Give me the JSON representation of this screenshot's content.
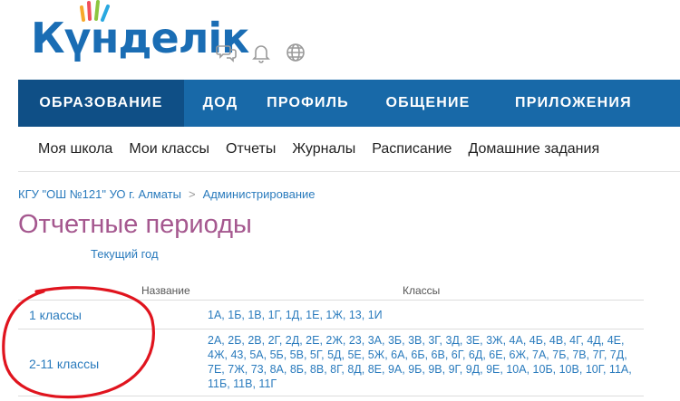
{
  "logo": {
    "text": "Күнделік"
  },
  "icons": [
    "chat-icon",
    "bell-icon",
    "globe-icon"
  ],
  "main_nav": [
    "ОБРАЗОВАНИЕ",
    "ДОД",
    "ПРОФИЛЬ",
    "ОБЩЕНИЕ",
    "ПРИЛОЖЕНИЯ"
  ],
  "sub_nav": [
    "Моя школа",
    "Мои классы",
    "Отчеты",
    "Журналы",
    "Расписание",
    "Домашние задания"
  ],
  "breadcrumb": [
    "КГУ \"ОШ №121\" УО г. Алматы",
    "Администрирование"
  ],
  "breadcrumb_sep": ">",
  "page_title": "Отчетные периоды",
  "subtitle": "Текущий год",
  "table": {
    "headers": {
      "name": "Название",
      "classes": "Классы"
    },
    "rows": [
      {
        "name": "1 классы",
        "classes": [
          "1А",
          "1Б",
          "1В",
          "1Г",
          "1Д",
          "1Е",
          "1Ж",
          "13",
          "1И"
        ]
      },
      {
        "name": "2-11 классы",
        "classes": [
          "2А",
          "2Б",
          "2В",
          "2Г",
          "2Д",
          "2Е",
          "2Ж",
          "23",
          "3А",
          "3Б",
          "3В",
          "3Г",
          "3Д",
          "3Е",
          "3Ж",
          "4А",
          "4Б",
          "4В",
          "4Г",
          "4Д",
          "4Е",
          "4Ж",
          "43",
          "5А",
          "5Б",
          "5В",
          "5Г",
          "5Д",
          "5Е",
          "5Ж",
          "6А",
          "6Б",
          "6В",
          "6Г",
          "6Д",
          "6Е",
          "6Ж",
          "7А",
          "7Б",
          "7В",
          "7Г",
          "7Д",
          "7Е",
          "7Ж",
          "73",
          "8А",
          "8Б",
          "8В",
          "8Г",
          "8Д",
          "8Е",
          "9А",
          "9Б",
          "9В",
          "9Г",
          "9Д",
          "9Е",
          "10А",
          "10Б",
          "10В",
          "10Г",
          "11А",
          "11Б",
          "11В",
          "11Г"
        ]
      }
    ]
  },
  "colors": {
    "nav_bg": "#1869a8",
    "nav_active": "#0f4f86",
    "link": "#2a7bbd",
    "title": "#a5588f",
    "annotation": "#e0141e"
  }
}
